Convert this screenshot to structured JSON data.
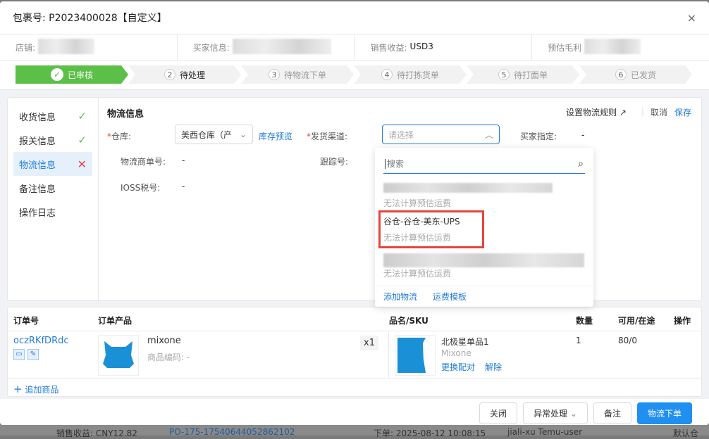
{
  "background_row": {
    "income": "销售收益: CNY12.82",
    "po": "PO-175-17540644052862102",
    "order_time": "下单: 2025-08-12 10:08:15",
    "user": "jiali-xu Temu-user",
    "tail": "默认仓"
  },
  "dialog": {
    "title": "包裹号: P2023400028【自定义】",
    "close_icon": "×"
  },
  "info": {
    "store_label": "店铺:",
    "buyer_label": "买家信息:",
    "income_label": "销售收益:",
    "income_value": "USD3",
    "profit_label": "预估毛利"
  },
  "steps": [
    {
      "num": "✓",
      "label": "已审核"
    },
    {
      "num": "2",
      "label": "待处理"
    },
    {
      "num": "3",
      "label": "待物流下单"
    },
    {
      "num": "4",
      "label": "待打拣货单"
    },
    {
      "num": "5",
      "label": "待打面单"
    },
    {
      "num": "6",
      "label": "已发货"
    }
  ],
  "sidebar": [
    {
      "label": "收货信息",
      "status": "✓"
    },
    {
      "label": "报关信息",
      "status": "✓"
    },
    {
      "label": "物流信息",
      "status": "✕"
    },
    {
      "label": "备注信息",
      "status": ""
    },
    {
      "label": "操作日志",
      "status": ""
    }
  ],
  "logistics": {
    "title": "物流信息",
    "set_rule": "设置物流规则",
    "cancel": "取消",
    "save": "保存",
    "warehouse_label": "仓库:",
    "warehouse_value": "美西仓库（产",
    "stock_preview": "库存预览",
    "channel_label": "发货渠道:",
    "channel_placeholder": "请选择",
    "buyer_spec_label": "买家指定:",
    "buyer_spec_value": "-",
    "carrier_no_label": "物流商单号:",
    "carrier_no_value": "-",
    "tracking_label": "跟踪号:",
    "ioss_label": "IOSS税号:",
    "ioss_value": "-"
  },
  "dropdown": {
    "search_placeholder": "搜索",
    "options": [
      {
        "name": "",
        "sub": "无法计算预估运费"
      },
      {
        "name": "谷仓-谷仓-美东-UPS",
        "sub": "无法计算预估运费"
      },
      {
        "name": "",
        "sub": "无法计算预估运费"
      }
    ],
    "add_logistics": "添加物流",
    "freight_template": "运费模板"
  },
  "table": {
    "headers": [
      "订单号",
      "订单产品",
      "品名/SKU",
      "数量",
      "可用/在途",
      "操作"
    ],
    "row": {
      "order_no": "oczRKfDRdc",
      "product_name": "mixone",
      "product_code": "商品编码: -",
      "qty_badge": "x1",
      "sku_name": "北极星单品1",
      "sku_brand": "Mixone",
      "rematch": "更换配对",
      "unbind": "解除",
      "qty": "1",
      "avail": "80/0"
    },
    "add_product": "追加商品"
  },
  "footer": {
    "close": "关闭",
    "exception": "异常处理",
    "remark": "备注",
    "ship": "物流下单"
  }
}
